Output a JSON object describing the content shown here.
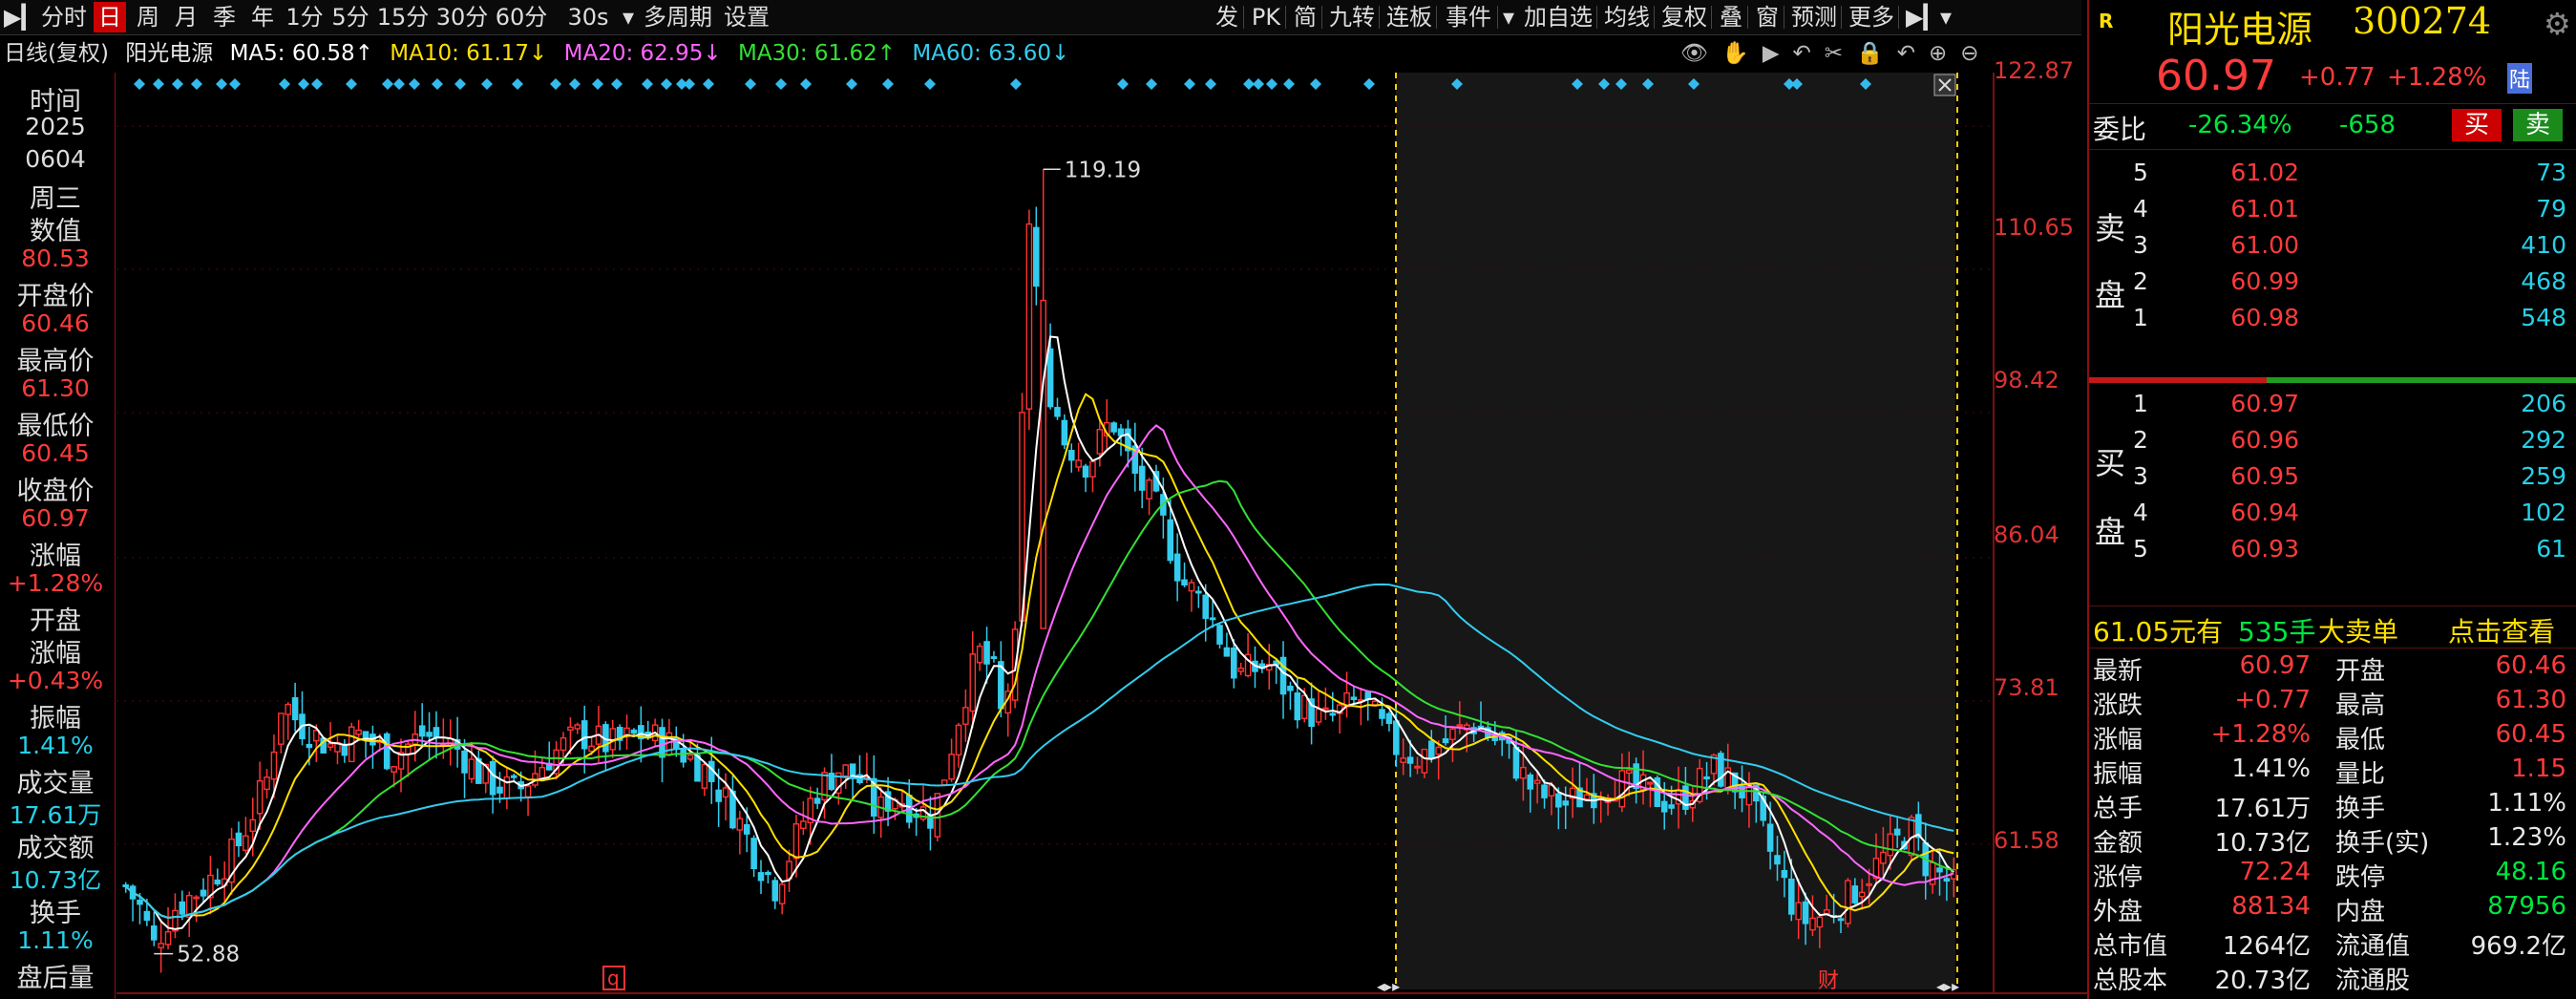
{
  "toolbar": {
    "items": [
      "分时",
      "日",
      "周",
      "月",
      "季",
      "年",
      "1分",
      "5分",
      "15分",
      "30分",
      "60分",
      "30s",
      "多周期",
      "设置"
    ],
    "right_items": [
      "发",
      "PK",
      "简",
      "九转",
      "连板",
      "事件",
      "加自选",
      "均线",
      "复权",
      "叠",
      "窗",
      "预测",
      "更多"
    ],
    "active": "日"
  },
  "legend": {
    "mode": "日线(复权)",
    "name": "阳光电源",
    "ma5": "MA5: 60.58↑",
    "ma10": "MA10: 61.17↓",
    "ma20": "MA20: 62.95↓",
    "ma30": "MA30: 61.62↑",
    "ma60": "MA60: 63.60↓"
  },
  "left_panel": {
    "time_label": "时间",
    "year": "2025",
    "date": "0604",
    "weekday": "周三",
    "value_label": "数值",
    "value": "80.53",
    "open_label": "开盘价",
    "open": "60.46",
    "high_label": "最高价",
    "high": "61.30",
    "low_label": "最低价",
    "low": "60.45",
    "close_label": "收盘价",
    "close": "60.97",
    "chg_label": "涨幅",
    "chg": "+1.28%",
    "open_chg_label1": "开盘",
    "open_chg_label2": "涨幅",
    "open_chg": "+0.43%",
    "amp_label": "振幅",
    "amp": "1.41%",
    "vol_label": "成交量",
    "vol": "17.61万",
    "amt_label": "成交额",
    "amt": "10.73亿",
    "turn_label": "换手",
    "turn": "1.11%",
    "after_label": "盘后量"
  },
  "chart_data": {
    "type": "candlestick",
    "y_ticks": [
      "122.87",
      "110.65",
      "98.42",
      "86.04",
      "73.81",
      "61.58"
    ],
    "ylim": [
      50,
      125
    ],
    "annotations": {
      "high": "119.19",
      "low": "52.88"
    },
    "markers": [
      "q",
      "财"
    ],
    "series_names": [
      "MA5",
      "MA10",
      "MA20",
      "MA30",
      "MA60"
    ],
    "colors": {
      "ma5": "#ffffff",
      "ma10": "#ffe000",
      "ma20": "#ff66ff",
      "ma30": "#33e033",
      "ma60": "#33ccee",
      "up": "#ff3333",
      "down": "#33ccee"
    }
  },
  "right_panel": {
    "name": "阳光电源",
    "code": "300274",
    "price": "60.97",
    "change": "+0.77",
    "pct": "+1.28%",
    "lu_tag": "陆",
    "weibi_label": "委比",
    "weibi": "-26.34%",
    "weicha": "-658",
    "buy_btn": "买",
    "sell_btn": "卖",
    "sell_label": [
      "卖",
      "盘"
    ],
    "buy_label": [
      "买",
      "盘"
    ],
    "asks": [
      {
        "lvl": "5",
        "price": "61.02",
        "vol": "73"
      },
      {
        "lvl": "4",
        "price": "61.01",
        "vol": "79"
      },
      {
        "lvl": "3",
        "price": "61.00",
        "vol": "410"
      },
      {
        "lvl": "2",
        "price": "60.99",
        "vol": "468"
      },
      {
        "lvl": "1",
        "price": "60.98",
        "vol": "548"
      }
    ],
    "bids": [
      {
        "lvl": "1",
        "price": "60.97",
        "vol": "206"
      },
      {
        "lvl": "2",
        "price": "60.96",
        "vol": "292"
      },
      {
        "lvl": "3",
        "price": "60.95",
        "vol": "259"
      },
      {
        "lvl": "4",
        "price": "60.94",
        "vol": "102"
      },
      {
        "lvl": "5",
        "price": "60.93",
        "vol": "61"
      }
    ],
    "big_order": {
      "price": "61.05元有",
      "vol": "535手",
      "label": "大卖单",
      "link": "点击查看"
    },
    "stats": [
      {
        "k1": "最新",
        "v1": "60.97",
        "c1": "red",
        "k2": "开盘",
        "v2": "60.46",
        "c2": "red"
      },
      {
        "k1": "涨跌",
        "v1": "+0.77",
        "c1": "red",
        "k2": "最高",
        "v2": "61.30",
        "c2": "red"
      },
      {
        "k1": "涨幅",
        "v1": "+1.28%",
        "c1": "red",
        "k2": "最低",
        "v2": "60.45",
        "c2": "red"
      },
      {
        "k1": "振幅",
        "v1": "1.41%",
        "c1": "white",
        "k2": "量比",
        "v2": "1.15",
        "c2": "red"
      },
      {
        "k1": "总手",
        "v1": "17.61万",
        "c1": "white",
        "k2": "换手",
        "v2": "1.11%",
        "c2": "white"
      },
      {
        "k1": "金额",
        "v1": "10.73亿",
        "c1": "white",
        "k2": "换手(实)",
        "v2": "1.23%",
        "c2": "white"
      },
      {
        "k1": "涨停",
        "v1": "72.24",
        "c1": "red",
        "k2": "跌停",
        "v2": "48.16",
        "c2": "green"
      },
      {
        "k1": "外盘",
        "v1": "88134",
        "c1": "red",
        "k2": "内盘",
        "v2": "87956",
        "c2": "green"
      },
      {
        "k1": "总市值",
        "v1": "1264亿",
        "c1": "white",
        "k2": "流通值",
        "v2": "969.2亿",
        "c2": "white"
      },
      {
        "k1": "总股本",
        "v1": "20.73亿",
        "c1": "white",
        "k2": "流通股",
        "v2": "",
        "c2": "white"
      }
    ]
  }
}
